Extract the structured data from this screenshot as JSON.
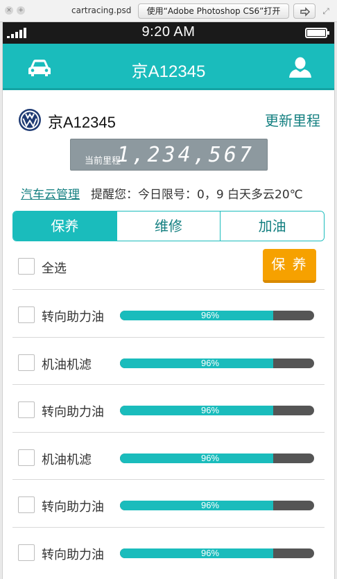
{
  "window": {
    "filename": "cartracing.psd",
    "open_with_label": "使用“Adobe Photoshop CS6”打开"
  },
  "status": {
    "time": "9:20 AM"
  },
  "nav": {
    "title": "京A12345",
    "left_icon": "car-icon",
    "right_icon": "user-icon"
  },
  "vehicle": {
    "brand_logo": "volkswagen-logo",
    "plate": "京A12345",
    "update_label": "更新里程"
  },
  "odometer": {
    "label": "当前里程",
    "value": "1,234,567"
  },
  "notice": {
    "link_label": "汽车云管理",
    "text": "提醒您：今日限号：0，9  白天多云20℃"
  },
  "tabs": [
    {
      "label": "保养",
      "active": true
    },
    {
      "label": "维修",
      "active": false
    },
    {
      "label": "加油",
      "active": false
    }
  ],
  "select_all": {
    "label": "全选",
    "action_label": "保 养"
  },
  "items": [
    {
      "name": "转向助力油",
      "percent_label": "96%",
      "level": 0.79
    },
    {
      "name": "机油机滤",
      "percent_label": "96%",
      "level": 0.79
    },
    {
      "name": "转向助力油",
      "percent_label": "96%",
      "level": 0.79
    },
    {
      "name": "机油机滤",
      "percent_label": "96%",
      "level": 0.79
    },
    {
      "name": "转向助力油",
      "percent_label": "96%",
      "level": 0.79
    },
    {
      "name": "转向助力油",
      "percent_label": "96%",
      "level": 0.79
    }
  ],
  "colors": {
    "accent": "#1abcbc",
    "accent_dark": "#137f80",
    "action": "#f6a100",
    "bar_track": "#555555"
  }
}
